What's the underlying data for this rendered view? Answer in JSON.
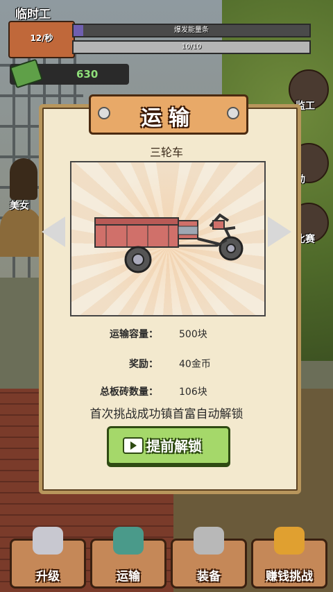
{
  "hud": {
    "title": "临时工",
    "rate": "12/秒",
    "bar1_label": "爆发能量条",
    "bar1_progress": 0.04,
    "bar2_label": "10/10",
    "bar2_progress": 1.0,
    "money": "630"
  },
  "side_left": {
    "label": "美女"
  },
  "side_right": [
    {
      "label": "监工",
      "icon": "foreman-icon"
    },
    {
      "label": "动",
      "icon": "activity-icon"
    },
    {
      "label": "比赛",
      "icon": "trophy-icon"
    }
  ],
  "modal": {
    "title": "运输",
    "item_name": "三轮车",
    "stats": [
      {
        "key": "运输容量：",
        "value": "500块"
      },
      {
        "key": "奖励：",
        "value": "40金币"
      },
      {
        "key": "总板砖数量：",
        "value": "106块"
      }
    ],
    "notice": "首次挑战成功镇首富自动解锁",
    "unlock_label": "提前解锁"
  },
  "nav": [
    {
      "label": "升级",
      "icon": "rocket-icon"
    },
    {
      "label": "运输",
      "icon": "truck-icon"
    },
    {
      "label": "装备",
      "icon": "gloves-icon"
    },
    {
      "label": "赚钱挑战",
      "icon": "helmet-icon"
    }
  ]
}
